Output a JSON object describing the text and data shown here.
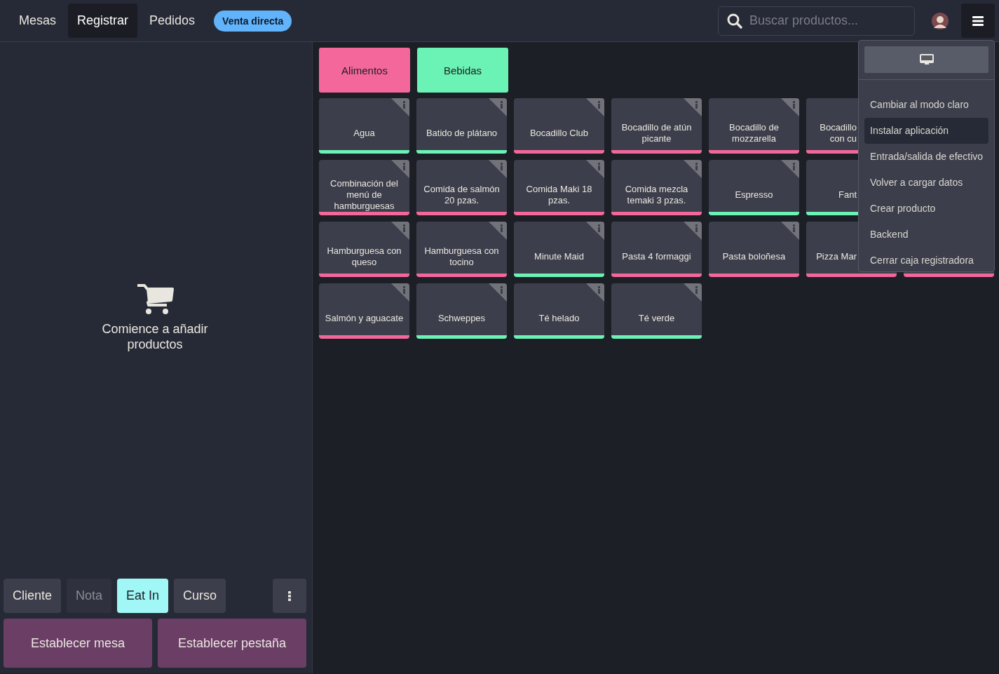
{
  "nav": {
    "tabs": [
      {
        "label": "Mesas",
        "selected": false
      },
      {
        "label": "Registrar",
        "selected": true
      },
      {
        "label": "Pedidos",
        "selected": false
      }
    ],
    "badge": "Venta directa"
  },
  "search": {
    "placeholder": "Buscar productos..."
  },
  "menu": {
    "open": true,
    "items": [
      {
        "label": "Cambiar al modo claro",
        "selected": false
      },
      {
        "label": "Instalar aplicación",
        "selected": true
      },
      {
        "label": "Entrada/salida de efectivo",
        "selected": false
      },
      {
        "label": "Volver a cargar datos",
        "selected": false
      },
      {
        "label": "Crear producto",
        "selected": false
      },
      {
        "label": "Backend",
        "selected": false
      },
      {
        "label": "Cerrar caja registradora",
        "selected": false
      }
    ]
  },
  "order": {
    "empty_message": "Comience a añadir productos",
    "actions": [
      {
        "label": "Cliente",
        "disabled": false,
        "selected": false
      },
      {
        "label": "Nota",
        "disabled": true,
        "selected": false
      },
      {
        "label": "Eat In",
        "disabled": false,
        "selected": true
      },
      {
        "label": "Curso",
        "disabled": false,
        "selected": false
      }
    ],
    "buttons": [
      "Establecer mesa",
      "Establecer pestaña"
    ]
  },
  "categories": [
    {
      "label": "Alimentos",
      "color": "#f4679b"
    },
    {
      "label": "Bebidas",
      "color": "#6bf2b5"
    }
  ],
  "product_rows": [
    [
      {
        "name": "Agua",
        "color": "#6bf2b5"
      },
      {
        "name": "Batido de plátano",
        "color": "#6bf2b5"
      },
      {
        "name": "Bocadillo Club",
        "color": "#f4679b"
      },
      {
        "name": "Bocadillo de atún picante",
        "color": "#f4679b"
      },
      {
        "name": "Bocadillo de mozzarella",
        "color": "#f4679b"
      },
      {
        "name": "Bocadillo con cu",
        "color": "#f4679b",
        "kind": "cut"
      }
    ],
    [
      {
        "name": "Combinación del menú de hamburguesas",
        "color": "#f4679b"
      },
      {
        "name": "Comida de salmón 20 pzas.",
        "color": "#f4679b"
      },
      {
        "name": "Comida Maki 18 pzas.",
        "color": "#f4679b"
      },
      {
        "name": "Comida mezcla temaki 3 pzas.",
        "color": "#f4679b"
      },
      {
        "name": "Espresso",
        "color": "#6bf2b5"
      },
      {
        "name": "Fant",
        "color": "#6bf2b5",
        "kind": "cut"
      }
    ],
    [
      {
        "name": "Hamburguesa con queso",
        "color": "#f4679b"
      },
      {
        "name": "Hamburguesa con tocino",
        "color": "#f4679b"
      },
      {
        "name": "Minute Maid",
        "color": "#6bf2b5"
      },
      {
        "name": "Pasta 4 formaggi",
        "color": "#f4679b"
      },
      {
        "name": "Pasta boloñesa",
        "color": "#f4679b"
      },
      {
        "name": "Pizza Mar",
        "color": "#f4679b",
        "kind": "cut"
      },
      {
        "color": "#f4679b",
        "kind": "cut"
      }
    ],
    [
      {
        "name": "Salmón y aguacate",
        "color": "#f4679b"
      },
      {
        "name": "Schweppes",
        "color": "#6bf2b5"
      },
      {
        "name": "Té helado",
        "color": "#6bf2b5"
      },
      {
        "name": "Té verde",
        "color": "#6bf2b5"
      }
    ]
  ]
}
